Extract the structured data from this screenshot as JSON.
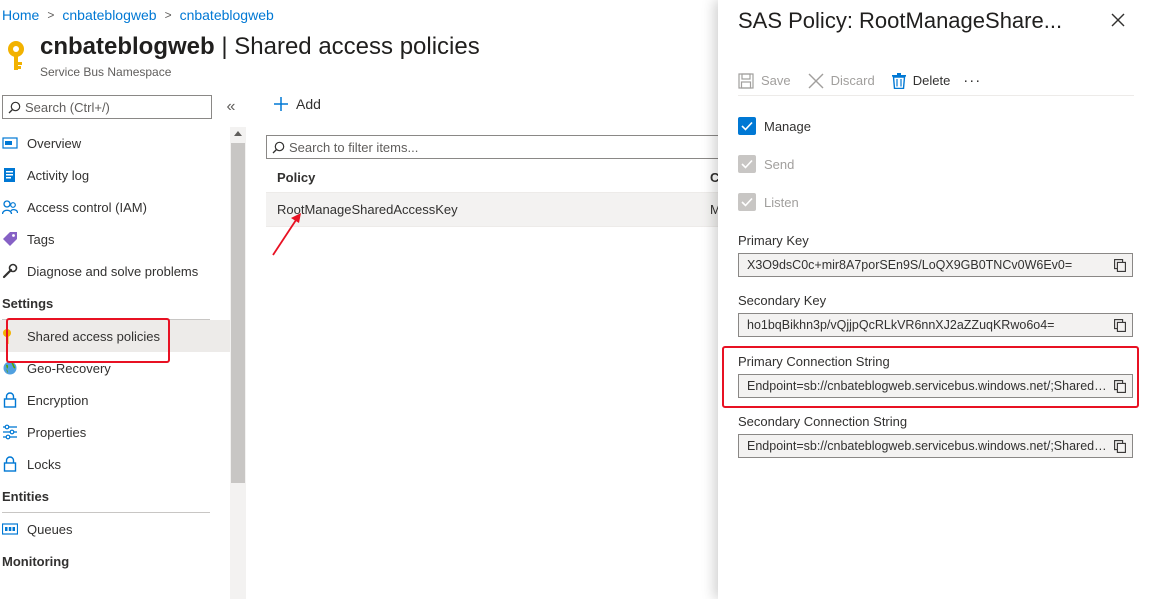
{
  "breadcrumb": {
    "items": [
      "Home",
      "cnbateblogweb",
      "cnbateblogweb"
    ]
  },
  "header": {
    "resource_name": "cnbateblogweb",
    "separator": " | ",
    "section": "Shared access policies",
    "subtitle": "Service Bus Namespace"
  },
  "sidebar": {
    "search_placeholder": "Search (Ctrl+/)",
    "collapse_glyph": "«",
    "items_top": [
      {
        "label": "Overview",
        "icon": "overview-icon"
      },
      {
        "label": "Activity log",
        "icon": "activity-log-icon"
      },
      {
        "label": "Access control (IAM)",
        "icon": "people-icon"
      },
      {
        "label": "Tags",
        "icon": "tag-icon"
      },
      {
        "label": "Diagnose and solve problems",
        "icon": "wrench-icon"
      }
    ],
    "section_settings": "Settings",
    "items_settings": [
      {
        "label": "Shared access policies",
        "icon": "key-icon"
      },
      {
        "label": "Geo-Recovery",
        "icon": "globe-icon"
      },
      {
        "label": "Encryption",
        "icon": "lock-icon"
      },
      {
        "label": "Properties",
        "icon": "properties-icon"
      },
      {
        "label": "Locks",
        "icon": "lock-icon"
      }
    ],
    "section_entities": "Entities",
    "items_entities": [
      {
        "label": "Queues",
        "icon": "queue-icon"
      }
    ],
    "section_monitoring": "Monitoring"
  },
  "main": {
    "add_label": "Add",
    "filter_placeholder": "Search to filter items...",
    "table": {
      "columns": [
        "Policy",
        "C"
      ],
      "rows": [
        {
          "policy": "RootManageSharedAccessKey",
          "claims": "M"
        }
      ]
    }
  },
  "blade": {
    "title": "SAS Policy: RootManageShare...",
    "toolbar": {
      "save": "Save",
      "discard": "Discard",
      "delete": "Delete",
      "more": "···"
    },
    "checkboxes": [
      {
        "label": "Manage",
        "checked": true,
        "disabled": false
      },
      {
        "label": "Send",
        "checked": true,
        "disabled": true
      },
      {
        "label": "Listen",
        "checked": true,
        "disabled": true
      }
    ],
    "fields": [
      {
        "label": "Primary Key",
        "value": "X3O9dsC0c+mir8A7porSEn9S/LoQX9GB0TNCv0W6Ev0="
      },
      {
        "label": "Secondary Key",
        "value": "ho1bqBikhn3p/vQjjpQcRLkVR6nnXJ2aZZuqKRwo6o4="
      },
      {
        "label": "Primary Connection String",
        "value": "Endpoint=sb://cnbateblogweb.servicebus.windows.net/;SharedAccessKeyName=RootManageSharedAccessKey"
      },
      {
        "label": "Secondary Connection String",
        "value": "Endpoint=sb://cnbateblogweb.servicebus.windows.net/;SharedAccessKeyName=RootManageSharedAccessKey"
      }
    ]
  },
  "colors": {
    "accent": "#0078d4",
    "highlight": "#e81123",
    "selected_bg": "#edebe9",
    "key_gold": "#f2b200"
  }
}
